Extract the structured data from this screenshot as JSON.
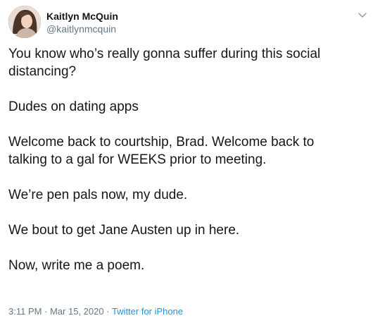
{
  "tweet": {
    "author": {
      "display_name": "Kaitlyn McQuin",
      "handle": "@kaitlynmcquin"
    },
    "lines": [
      "You know who’s really gonna suffer during this social",
      "distancing?",
      "",
      "Dudes on dating apps",
      "",
      "Welcome back to courtship, Brad. Welcome back to",
      "talking to a gal for WEEKS prior to meeting.",
      "",
      "We’re pen pals now, my dude.",
      "",
      "We bout to get Jane Austen up in here.",
      "",
      "Now, write me a poem."
    ],
    "timestamp": "3:11 PM · Mar 15, 2020 · ",
    "source": "Twitter for iPhone"
  },
  "icons": {
    "avatar": "avatar-photo",
    "menu": "chevron-down-icon"
  },
  "colors": {
    "text": "#14171a",
    "secondary": "#657786",
    "link": "#1b95e0"
  }
}
